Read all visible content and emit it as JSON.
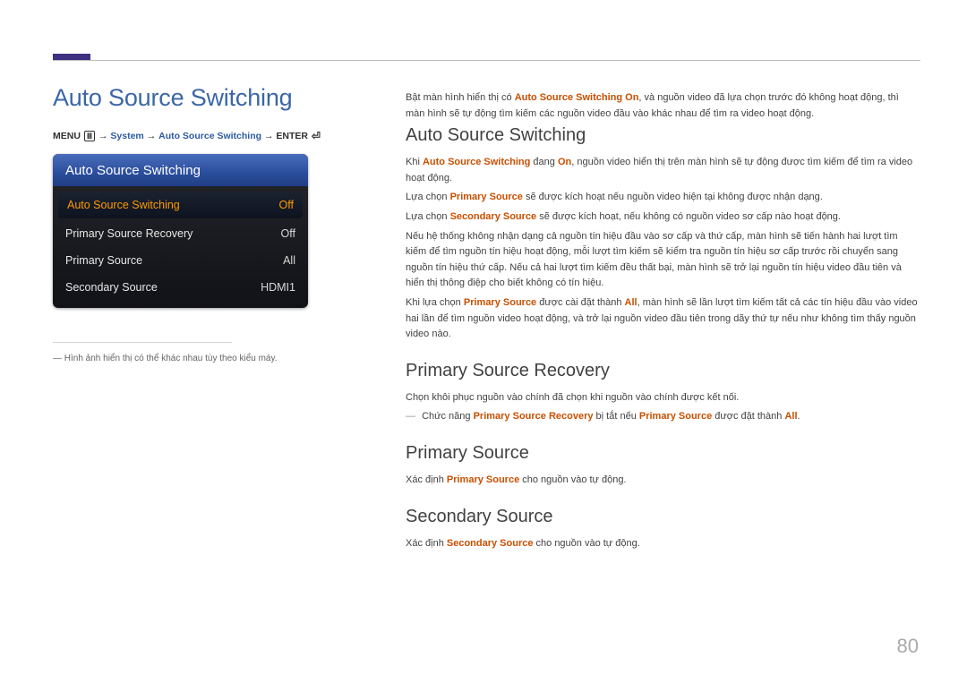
{
  "page_number": "80",
  "accent_color": "#3e3182",
  "link_color": "#3b67a6",
  "highlight_color": "#c94f00",
  "left": {
    "title": "Auto Source Switching",
    "breadcrumb": {
      "menu": "MENU",
      "path1": "System",
      "path2": "Auto Source Switching",
      "enter": "ENTER"
    },
    "osd": {
      "header": "Auto Source Switching",
      "rows": [
        {
          "label": "Auto Source Switching",
          "value": "Off",
          "selected": true
        },
        {
          "label": "Primary Source Recovery",
          "value": "Off",
          "selected": false
        },
        {
          "label": "Primary Source",
          "value": "All",
          "selected": false
        },
        {
          "label": "Secondary Source",
          "value": "HDMI1",
          "selected": false
        }
      ]
    },
    "footnote": "Hình ảnh hiển thị có thể khác nhau tùy theo kiểu máy."
  },
  "right": {
    "intro_pre": "Bật màn hình hiển thị có ",
    "intro_hl": "Auto Source Switching On",
    "intro_post": ", và nguồn video đã lựa chọn trước đó không hoạt động, thì màn hình sẽ tự động tìm kiếm các nguồn video đầu vào khác nhau để tìm ra video hoạt động.",
    "s1": {
      "heading": "Auto Source Switching",
      "p1a": "Khi ",
      "p1hl1": "Auto Source Switching",
      "p1b": " đang ",
      "p1hl2": "On",
      "p1c": ", nguồn video hiển thị trên màn hình sẽ tự động được tìm kiếm để tìm ra video hoạt động.",
      "p2a": "Lựa chọn ",
      "p2hl": "Primary Source",
      "p2b": " sẽ được kích hoạt nếu nguồn video hiện tại không được nhận dạng.",
      "p3a": "Lựa chọn ",
      "p3hl": "Secondary Source",
      "p3b": " sẽ được kích hoạt, nếu không có nguồn video sơ cấp nào hoạt động.",
      "p4": "Nếu hệ thống không nhận dạng cả nguồn tín hiệu đầu vào sơ cấp và thứ cấp, màn hình sẽ tiến hành hai lượt tìm kiếm để tìm nguồn tín hiệu hoạt động, mỗi lượt tìm kiếm sẽ kiểm tra nguồn tín hiệu sơ cấp trước rồi chuyển sang nguồn tín hiệu thứ cấp. Nếu cả hai lượt tìm kiếm đều thất bại, màn hình sẽ trở lại nguồn tín hiệu video đầu tiên và hiển thị thông điệp cho biết không có tín hiệu.",
      "p5a": "Khi lựa chọn ",
      "p5hl1": "Primary Source",
      "p5b": " được cài đặt thành ",
      "p5hl2": "All",
      "p5c": ", màn hình sẽ lần lượt tìm kiếm tất cả các tín hiệu đầu vào video hai lần để tìm nguồn video hoạt động, và trở lại nguồn video đầu tiên trong dãy thứ tự nếu như không tìm thấy nguồn video nào."
    },
    "s2": {
      "heading": "Primary Source Recovery",
      "p1": "Chọn khôi phục nguồn vào chính đã chọn khi nguồn vào chính được kết nối.",
      "note_pre": "Chức năng ",
      "note_hl1": "Primary Source Recovery",
      "note_mid": " bị tắt nếu ",
      "note_hl2": "Primary Source",
      "note_post": " được đặt thành ",
      "note_hl3": "All",
      "note_end": "."
    },
    "s3": {
      "heading": "Primary Source",
      "p1a": "Xác định ",
      "p1hl": "Primary Source",
      "p1b": " cho nguồn vào tự động."
    },
    "s4": {
      "heading": "Secondary Source",
      "p1a": "Xác định ",
      "p1hl": "Secondary Source",
      "p1b": " cho nguồn vào tự động."
    }
  }
}
